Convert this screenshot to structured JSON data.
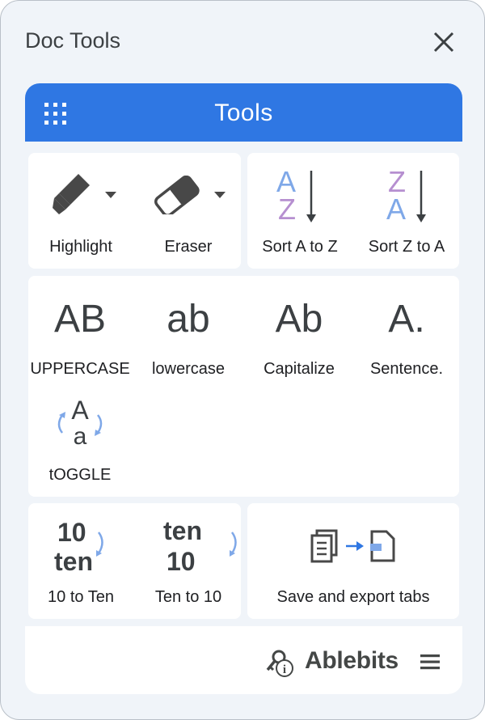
{
  "window": {
    "title": "Doc Tools"
  },
  "tools_header": {
    "title": "Tools"
  },
  "groups": {
    "highlight": {
      "label": "Highlight"
    },
    "eraser": {
      "label": "Eraser"
    },
    "sort_az": {
      "label": "Sort A to Z",
      "glyph_top": "A",
      "glyph_bottom": "Z"
    },
    "sort_za": {
      "label": "Sort Z to A",
      "glyph_top": "Z",
      "glyph_bottom": "A"
    }
  },
  "case_tools": {
    "upper": {
      "label": "UPPERCASE",
      "glyph": "AB"
    },
    "lower": {
      "label": "lowercase",
      "glyph": "ab"
    },
    "capitalize": {
      "label": "Capitalize",
      "glyph": "Ab"
    },
    "sentence": {
      "label": "Sentence.",
      "glyph": "A."
    },
    "toggle": {
      "label": "tOGGLE",
      "glyph_top": "A",
      "glyph_bottom": "a"
    }
  },
  "number_tools": {
    "num_to_text": {
      "label": "10 to Ten",
      "glyph_top": "10",
      "glyph_bottom": "ten"
    },
    "text_to_num": {
      "label": "Ten to 10",
      "glyph_top": "ten",
      "glyph_bottom": "10"
    }
  },
  "export": {
    "label": "Save and export tabs"
  },
  "footer": {
    "brand": "Ablebits"
  },
  "colors": {
    "accent": "#2f77e3",
    "sort_purple": "#b68fd0",
    "sort_blue": "#7fa8e8"
  },
  "icons": [
    "close-icon",
    "apps-grid-icon",
    "highlighter-icon",
    "eraser-icon",
    "dropdown-arrow-icon",
    "sort-arrow-icon",
    "refresh-arrows-icon",
    "documents-icon",
    "export-arrow-icon",
    "key-info-icon",
    "menu-icon"
  ]
}
